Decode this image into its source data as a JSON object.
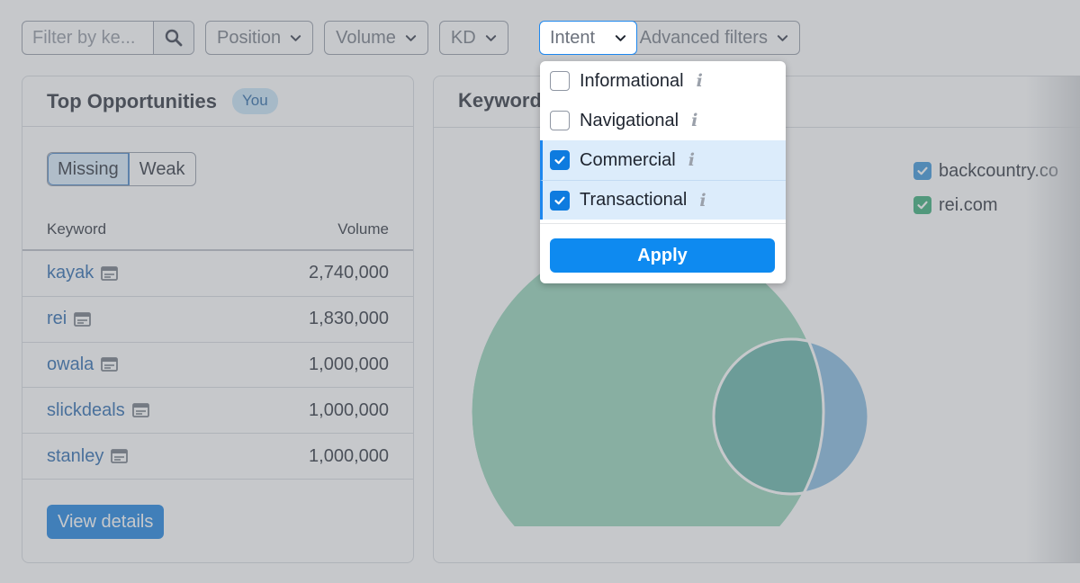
{
  "filters": {
    "search_placeholder": "Filter by ke...",
    "position_label": "Position",
    "volume_label": "Volume",
    "kd_label": "KD",
    "intent_label": "Intent",
    "advanced_label": "Advanced filters"
  },
  "top_opportunities": {
    "title": "Top Opportunities",
    "badge": "You",
    "tabs": [
      {
        "label": "Missing",
        "active": true
      },
      {
        "label": "Weak",
        "active": false
      }
    ],
    "columns": {
      "keyword": "Keyword",
      "volume": "Volume"
    },
    "rows": [
      {
        "keyword": "kayak",
        "volume": "2,740,000"
      },
      {
        "keyword": "rei",
        "volume": "1,830,000"
      },
      {
        "keyword": "owala",
        "volume": "1,000,000"
      },
      {
        "keyword": "slickdeals",
        "volume": "1,000,000"
      },
      {
        "keyword": "stanley",
        "volume": "1,000,000"
      }
    ],
    "view_details": "View details"
  },
  "keyword_overlap": {
    "title": "Keyword",
    "legend": [
      {
        "label": "backcountry.co",
        "color": "#2f8fd8"
      },
      {
        "label": "rei.com",
        "color": "#2aa86f"
      }
    ],
    "colors": {
      "rei_circle": "#8fd1b4",
      "backcountry_circle": "#7fb6de",
      "overlap": "#5bb0a3"
    }
  },
  "intent_dropdown": {
    "options": [
      {
        "label": "Informational",
        "checked": false
      },
      {
        "label": "Navigational",
        "checked": false
      },
      {
        "label": "Commercial",
        "checked": true
      },
      {
        "label": "Transactional",
        "checked": true
      }
    ],
    "apply_label": "Apply",
    "info_glyph": "i"
  }
}
